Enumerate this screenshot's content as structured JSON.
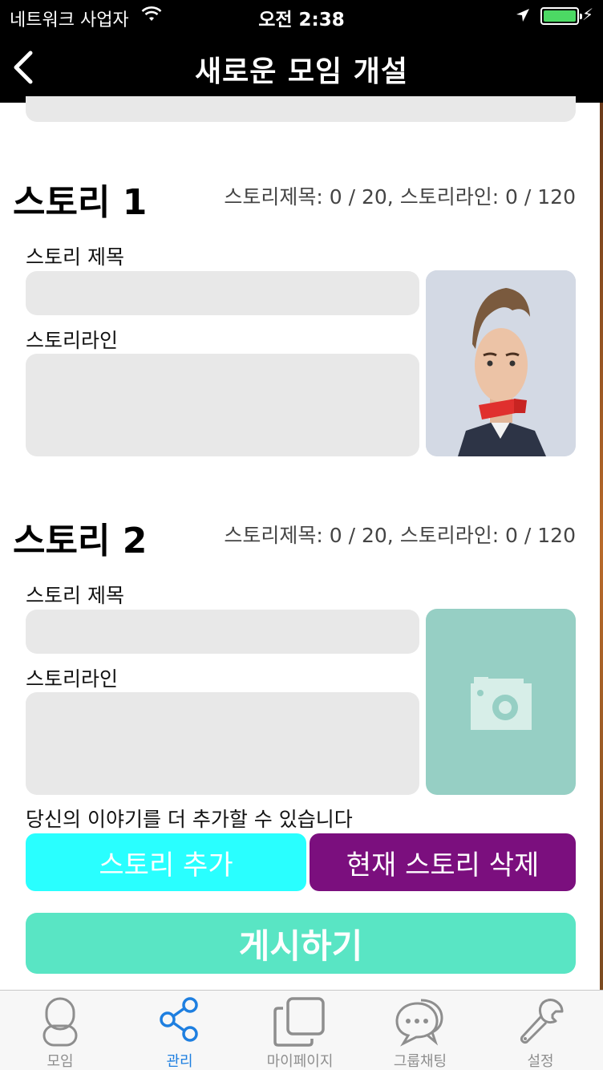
{
  "status_bar": {
    "carrier": "네트워크 사업자",
    "time": "오전 2:38"
  },
  "nav": {
    "title": "새로운 모임 개설",
    "back_icon": "chevron-left-icon"
  },
  "stories": [
    {
      "title": "스토리 1",
      "counter": "스토리제목: 0 / 20, 스토리라인: 0 / 120",
      "title_label": "스토리 제목",
      "line_label": "스토리라인",
      "title_value": "",
      "line_value": "",
      "photo": "person-photo"
    },
    {
      "title": "스토리 2",
      "counter": "스토리제목: 0 / 20, 스토리라인: 0 / 120",
      "title_label": "스토리 제목",
      "line_label": "스토리라인",
      "title_value": "",
      "line_value": "",
      "photo": "camera-icon"
    }
  ],
  "hint": "당신의 이야기를 더 추가할 수 있습니다",
  "buttons": {
    "add_story": "스토리 추가",
    "delete_story": "현재 스토리 삭제",
    "post": "게시하기"
  },
  "colors": {
    "add_button": "#29ffff",
    "delete_button": "#7b0f7e",
    "post_button": "#59e5c4",
    "photo_placeholder": "#96cfc4",
    "active_tab": "#1e7fe0"
  },
  "tabs": [
    {
      "label": "모임",
      "icon": "person-icon",
      "active": false
    },
    {
      "label": "관리",
      "icon": "share-icon",
      "active": true
    },
    {
      "label": "마이페이지",
      "icon": "pages-icon",
      "active": false
    },
    {
      "label": "그룹채팅",
      "icon": "chat-bubbles-icon",
      "active": false
    },
    {
      "label": "설정",
      "icon": "wrench-icon",
      "active": false
    }
  ]
}
